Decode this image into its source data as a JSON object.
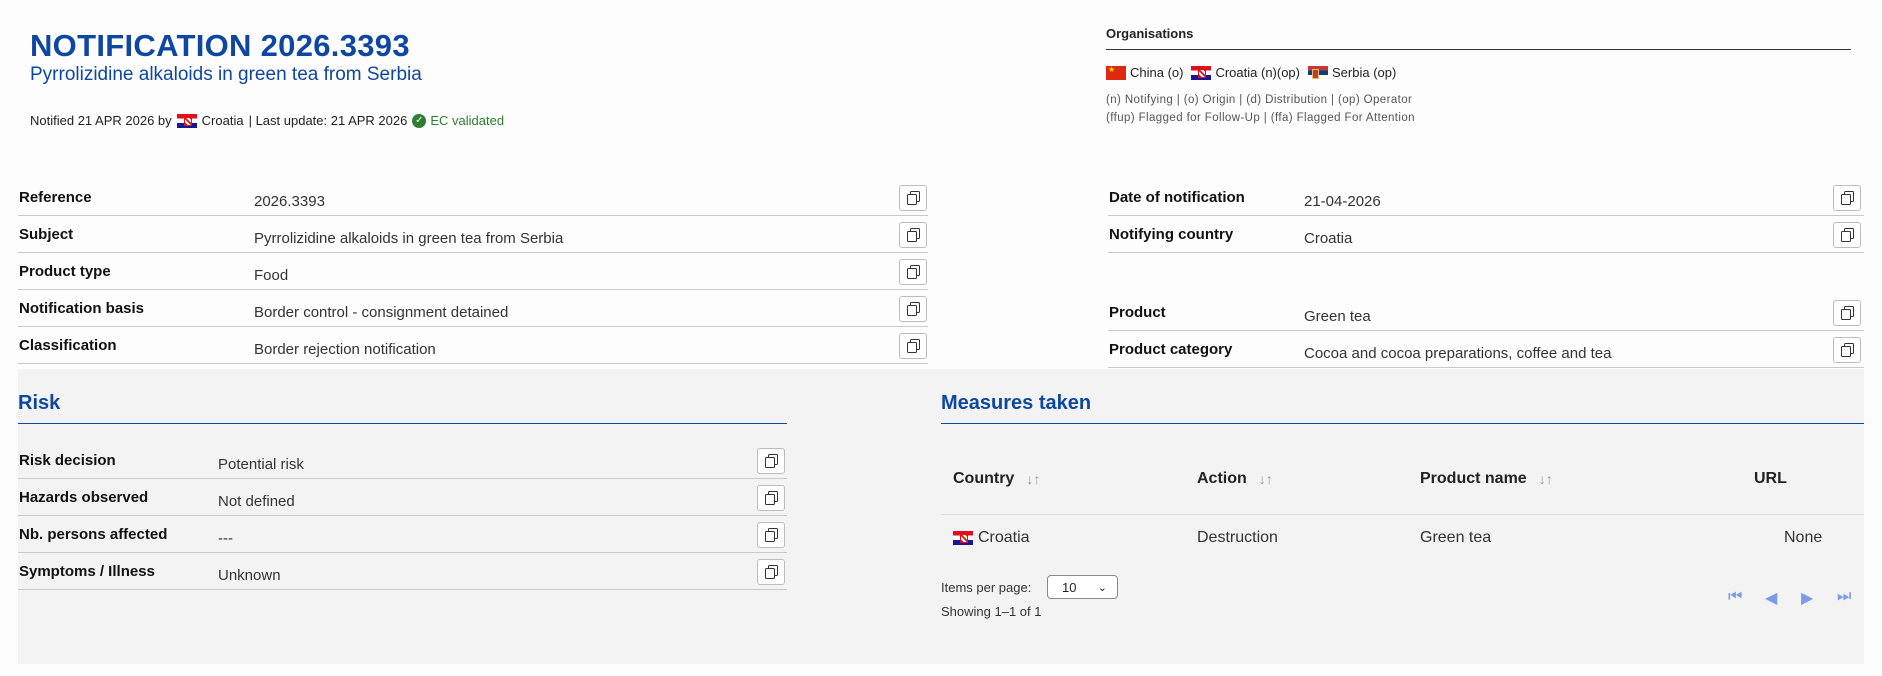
{
  "header": {
    "title": "NOTIFICATION 2026.3393",
    "subtitle": "Pyrrolizidine alkaloids in green tea from Serbia",
    "notified_prefix": "Notified 21 APR 2026 by",
    "notified_country": "Croatia",
    "last_update": "| Last update: 21 APR 2026",
    "validated": "EC validated"
  },
  "organisations": {
    "title": "Organisations",
    "items": [
      {
        "flag": "flag-china",
        "label": "China (o)"
      },
      {
        "flag": "flag-croatia",
        "label": "Croatia (n)(op)"
      },
      {
        "flag": "flag-serbia",
        "label": "Serbia (op)"
      }
    ],
    "legend_line1": "(n) Notifying | (o) Origin | (d) Distribution | (op) Operator",
    "legend_line2": "(ffup) Flagged for Follow-Up | (ffa) Flagged For Attention"
  },
  "details_left": [
    {
      "label": "Reference",
      "value": "2026.3393"
    },
    {
      "label": "Subject",
      "value": "Pyrrolizidine alkaloids in green tea from Serbia"
    },
    {
      "label": "Product type",
      "value": "Food"
    },
    {
      "label": "Notification basis",
      "value": "Border control - consignment detained"
    },
    {
      "label": "Classification",
      "value": "Border rejection notification"
    }
  ],
  "details_right": [
    {
      "label": "Date of notification",
      "value": "21-04-2026"
    },
    {
      "label": "Notifying country",
      "value": "Croatia"
    },
    {
      "label": "Product",
      "value": "Green tea"
    },
    {
      "label": "Product category",
      "value": "Cocoa and cocoa preparations, coffee and tea"
    }
  ],
  "risk": {
    "title": "Risk",
    "rows": [
      {
        "label": "Risk decision",
        "value": "Potential risk"
      },
      {
        "label": "Hazards observed",
        "value": "Not defined"
      },
      {
        "label": "Nb. persons affected",
        "value": "---"
      },
      {
        "label": "Symptoms / Illness",
        "value": "Unknown"
      }
    ]
  },
  "measures": {
    "title": "Measures taken",
    "columns": [
      "Country",
      "Action",
      "Product name",
      "URL"
    ],
    "rows": [
      {
        "country": "Croatia",
        "action": "Destruction",
        "product": "Green tea",
        "url": "None"
      }
    ],
    "items_per_page_label": "Items per page:",
    "items_per_page_value": "10",
    "showing": "Showing 1–1 of 1"
  },
  "icons": {
    "copy": "copy-icon",
    "check": "check-circle-icon",
    "sort": "sort-icon",
    "pager": [
      "first-page-icon",
      "prev-page-icon",
      "next-page-icon",
      "last-page-icon"
    ]
  },
  "colors": {
    "accent": "#0e47a1",
    "validated": "#2e7d32",
    "pager": "#7b9be6"
  }
}
